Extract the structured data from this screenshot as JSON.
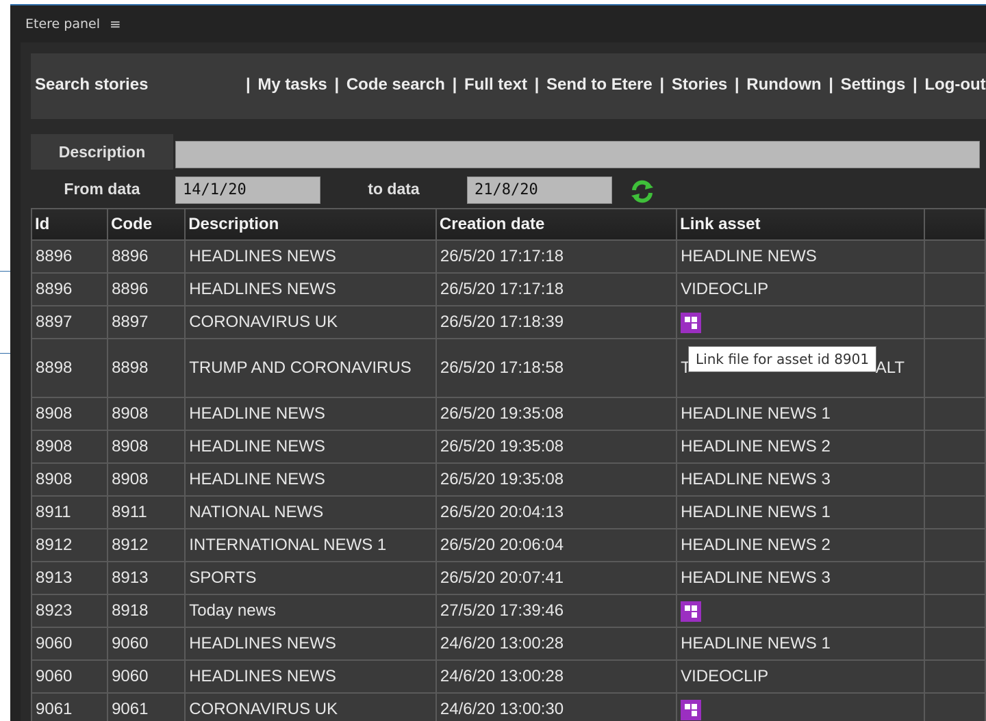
{
  "panel": {
    "title": "Etere panel",
    "menu_icon": "hamburger-icon"
  },
  "nav": {
    "title": "Search stories",
    "links": [
      "My tasks",
      "Code search",
      "Full text",
      "Send to Etere",
      "Stories",
      "Rundown",
      "Settings",
      "Log-out"
    ]
  },
  "form": {
    "description_label": "Description",
    "description_value": "",
    "from_label": "From data",
    "from_value": "14/1/20",
    "to_label": "to data",
    "to_value": "21/8/20",
    "refresh_icon": "refresh-icon"
  },
  "table": {
    "columns": [
      "Id",
      "Code",
      "Description",
      "Creation date",
      "Link asset"
    ],
    "rows": [
      {
        "id": "8896",
        "code": "8896",
        "description": "HEADLINES NEWS",
        "date": "26/5/20 17:17:18",
        "link": "HEADLINE NEWS"
      },
      {
        "id": "8896",
        "code": "8896",
        "description": "HEADLINES NEWS",
        "date": "26/5/20 17:17:18",
        "link": "VIDEOCLIP"
      },
      {
        "id": "8897",
        "code": "8897",
        "description": "CORONAVIRUS UK",
        "date": "26/5/20 17:18:39",
        "link": "",
        "link_icon": "asset-link-icon"
      },
      {
        "id": "8898",
        "code": "8898",
        "description": "TRUMP AND CORONAVIRUS",
        "date": "26/5/20 17:18:58",
        "link": "T",
        "link_tail": "ALT"
      },
      {
        "id": "8908",
        "code": "8908",
        "description": "HEADLINE NEWS",
        "date": "26/5/20 19:35:08",
        "link": "HEADLINE NEWS 1"
      },
      {
        "id": "8908",
        "code": "8908",
        "description": "HEADLINE NEWS",
        "date": "26/5/20 19:35:08",
        "link": "HEADLINE NEWS 2"
      },
      {
        "id": "8908",
        "code": "8908",
        "description": "HEADLINE NEWS",
        "date": "26/5/20 19:35:08",
        "link": "HEADLINE NEWS 3"
      },
      {
        "id": "8911",
        "code": "8911",
        "description": "NATIONAL NEWS",
        "date": "26/5/20 20:04:13",
        "link": "HEADLINE NEWS 1"
      },
      {
        "id": "8912",
        "code": "8912",
        "description": "INTERNATIONAL NEWS 1",
        "date": "26/5/20 20:06:04",
        "link": "HEADLINE NEWS 2"
      },
      {
        "id": "8913",
        "code": "8913",
        "description": "SPORTS",
        "date": "26/5/20 20:07:41",
        "link": "HEADLINE NEWS 3"
      },
      {
        "id": "8923",
        "code": "8918",
        "description": "Today news",
        "date": "27/5/20 17:39:46",
        "link": "",
        "link_icon": "asset-link-icon"
      },
      {
        "id": "9060",
        "code": "9060",
        "description": "HEADLINES NEWS",
        "date": "24/6/20 13:00:28",
        "link": "HEADLINE NEWS 1"
      },
      {
        "id": "9060",
        "code": "9060",
        "description": "HEADLINES NEWS",
        "date": "24/6/20 13:00:28",
        "link": "VIDEOCLIP"
      },
      {
        "id": "9061",
        "code": "9061",
        "description": "CORONAVIRUS UK",
        "date": "24/6/20 13:00:30",
        "link": "",
        "link_icon": "asset-link-icon"
      }
    ]
  },
  "tooltip": {
    "text": "Link file for asset id 8901"
  },
  "colors": {
    "accent": "#2f6da8",
    "asset_icon": "#9b2fc1",
    "refresh": "#3fbf3a"
  }
}
